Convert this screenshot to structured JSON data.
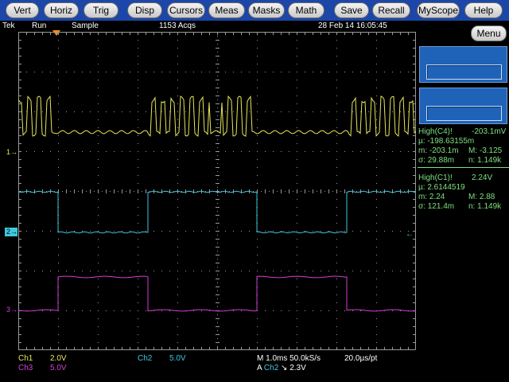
{
  "menubar": {
    "buttons": [
      "Vert",
      "Horiz",
      "Trig",
      "Disp",
      "Cursors",
      "Meas",
      "Masks",
      "Math",
      "Save",
      "Recall",
      "MyScope",
      "Help"
    ]
  },
  "status": {
    "brand": "Tek",
    "run_state": "Run",
    "mode": "Sample",
    "acqs": "1153 Acqs",
    "datetime": "28 Feb 14 16:05:45"
  },
  "side_menu": {
    "menu_label": "Menu"
  },
  "measurements": {
    "c4": {
      "title": "High(C4)!",
      "value": "-203.1mV",
      "mu": "µ:  -198.63155m",
      "m_min": "m: -203.1m",
      "m_max": "M: -3.125",
      "sigma": "σ:  29.88m",
      "n": "n:  1.149k"
    },
    "c1": {
      "title": "High(C1)!",
      "value": "2.24V",
      "mu": "µ:  2.6144519",
      "m_min": "m: 2.24",
      "m_max": "M: 2.88",
      "sigma": "σ:  121.4m",
      "n": "n:  1.149k"
    }
  },
  "channel_markers": {
    "ch1": "1",
    "ch2": "2",
    "ch3": "3"
  },
  "readouts": {
    "ch1_label": "Ch1",
    "ch1_scale": "2.0V",
    "ch3_label": "Ch3",
    "ch3_scale": "5.0V",
    "ch2_label": "Ch2",
    "ch2_scale": "5.0V",
    "timebase": "M 1.0ms 50.0kS/s",
    "resolution": "20.0µs/pt",
    "trigger_prefix": "A",
    "trigger_source": "Ch2",
    "trigger_slope": "↘",
    "trigger_level": "2.3V"
  },
  "colors": {
    "ch1": "#e6e65a",
    "ch2": "#3ec8dc",
    "ch3": "#d43ed4",
    "measurement": "#7ee07e",
    "menubar": "#1c46a8",
    "grid": "#9a9a9a",
    "trigger_marker": "#ff8a1e"
  },
  "icons": [
    "trigger-position-marker-icon",
    "ch1-ground-marker-icon",
    "ch2-ground-marker-icon",
    "ch3-ground-marker-icon",
    "trigger-level-arrow-icon"
  ]
}
